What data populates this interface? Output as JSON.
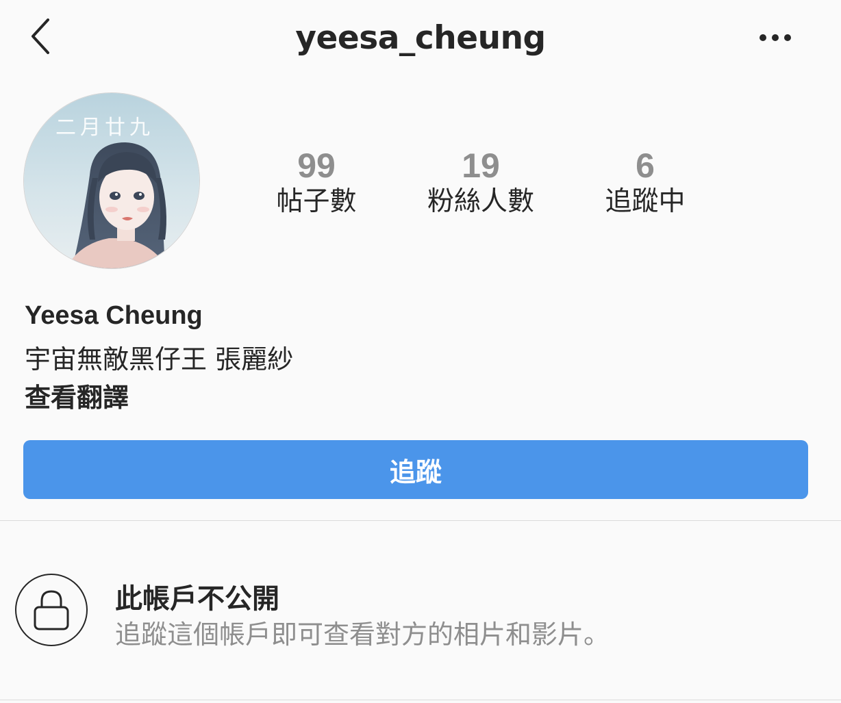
{
  "header": {
    "username": "yeesa_cheung",
    "back_icon": "chevron-left-icon",
    "more_icon": "more-horizontal-icon"
  },
  "profile": {
    "avatar_text": "二月廿九",
    "stats": [
      {
        "count": "99",
        "label": "帖子數"
      },
      {
        "count": "19",
        "label": "粉絲人數"
      },
      {
        "count": "6",
        "label": "追蹤中"
      }
    ],
    "display_name": "Yeesa Cheung",
    "bio": "宇宙無敵黑仔王 張麗紗",
    "translate_label": "查看翻譯"
  },
  "actions": {
    "follow_label": "追蹤",
    "follow_color": "#4b95ea"
  },
  "private_notice": {
    "icon": "lock-icon",
    "title": "此帳戶不公開",
    "description": "追蹤這個帳戶即可查看對方的相片和影片。"
  }
}
